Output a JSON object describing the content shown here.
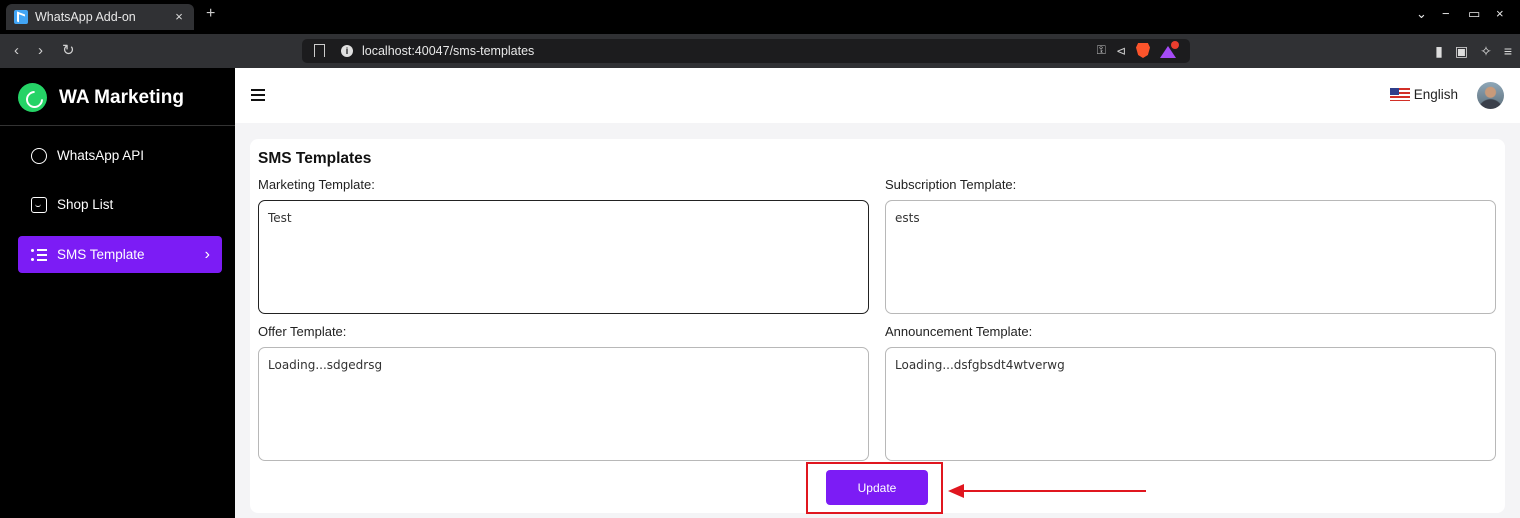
{
  "browser": {
    "tab_title": "WhatsApp Add-on",
    "tab_close": "×",
    "new_tab": "+",
    "url": "localhost:40047/sms-templates",
    "controls": {
      "minimize": "−",
      "maximize": "▭",
      "close": "×",
      "dropdown": "⌄"
    },
    "nav": {
      "back": "‹",
      "forward": "›",
      "reload": "↻"
    },
    "url_icons": {
      "key": "⚿",
      "share": "⊲"
    },
    "toolbar": {
      "sidebar": "▮",
      "wallet": "▣",
      "leo": "✧",
      "menu": "≡"
    }
  },
  "sidebar": {
    "brand": "WA Marketing",
    "items": [
      {
        "label": "WhatsApp API",
        "icon": "whatsapp-icon",
        "active": false
      },
      {
        "label": "Shop List",
        "icon": "shop-icon",
        "active": false
      },
      {
        "label": "SMS Template",
        "icon": "list-icon",
        "active": true
      }
    ],
    "active_chevron": "›"
  },
  "header": {
    "language": "English"
  },
  "page": {
    "title": "SMS Templates",
    "marketing": {
      "label": "Marketing Template:",
      "value": "Test"
    },
    "subscription": {
      "label": "Subscription Template:",
      "value": "ests"
    },
    "offer": {
      "label": "Offer Template:",
      "value": "Loading...sdgedrsg"
    },
    "announcement": {
      "label": "Announcement Template:",
      "value": "Loading...dsfgbsdt4wtverwg"
    },
    "update_label": "Update"
  },
  "colors": {
    "accent": "#7c1cf5",
    "whatsapp": "#25d366",
    "annotation": "#e0161f"
  }
}
